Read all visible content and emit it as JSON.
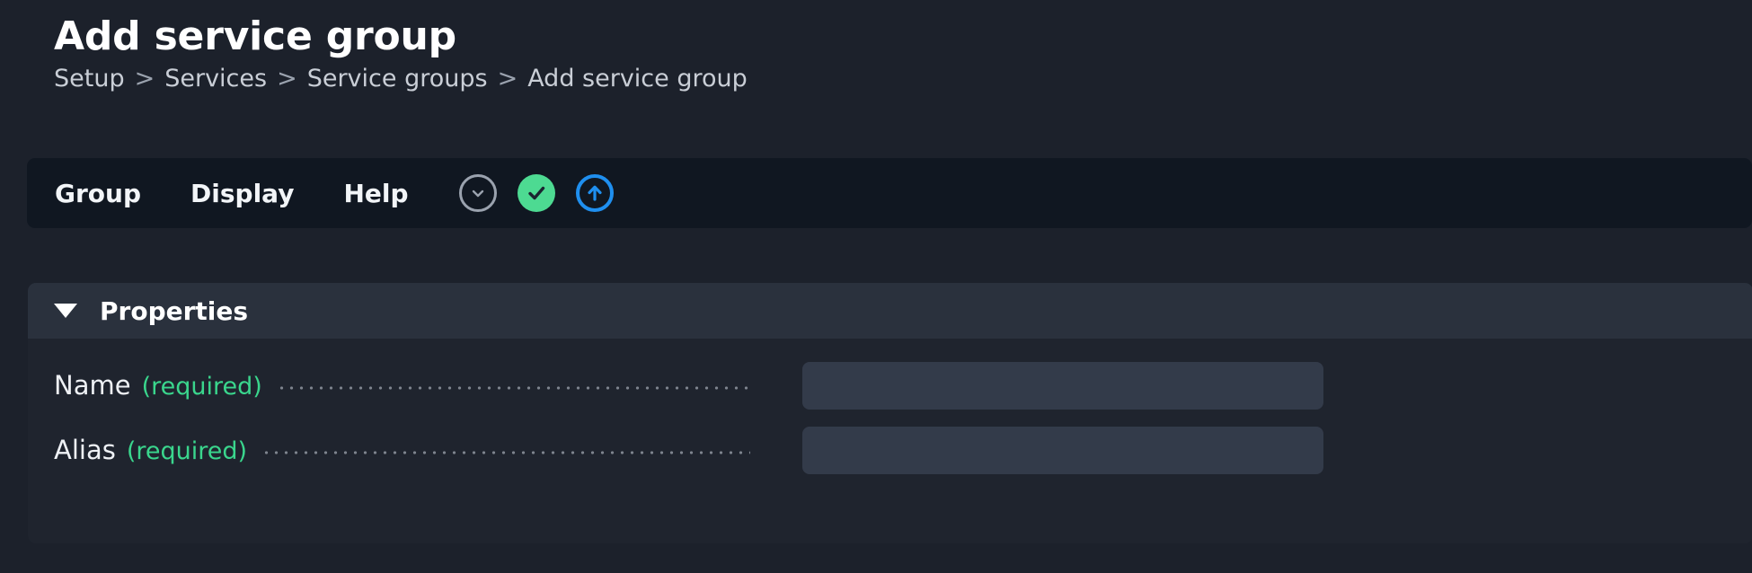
{
  "header": {
    "title": "Add service group",
    "breadcrumb": [
      {
        "label": "Setup",
        "sep": ">"
      },
      {
        "label": "Services",
        "sep": ">"
      },
      {
        "label": "Service groups",
        "sep": ">"
      },
      {
        "label": "Add service group",
        "sep": ""
      }
    ]
  },
  "toolbar": {
    "tabs": [
      {
        "label": "Group"
      },
      {
        "label": "Display"
      },
      {
        "label": "Help"
      }
    ],
    "icons": [
      {
        "name": "chevron-down-icon",
        "color": "#9aa2ae"
      },
      {
        "name": "check-circle-icon",
        "color": "#4dda92"
      },
      {
        "name": "upload-arrow-icon",
        "color": "#1f8fef"
      }
    ]
  },
  "properties_section": {
    "collapse_icon": "caret-down-icon",
    "title": "Properties",
    "fields": [
      {
        "label": "Name",
        "required_text": "(required)",
        "value": "",
        "placeholder": ""
      },
      {
        "label": "Alias",
        "required_text": "(required)",
        "value": "",
        "placeholder": ""
      }
    ]
  },
  "colors": {
    "page_background": "#1c212b",
    "toolbar_background": "#101721",
    "card_background": "#1f242e",
    "card_header_background": "#2a313d",
    "input_background": "#333b4a",
    "accent_green": "#3ad68d",
    "accent_blue": "#1f8fef"
  }
}
